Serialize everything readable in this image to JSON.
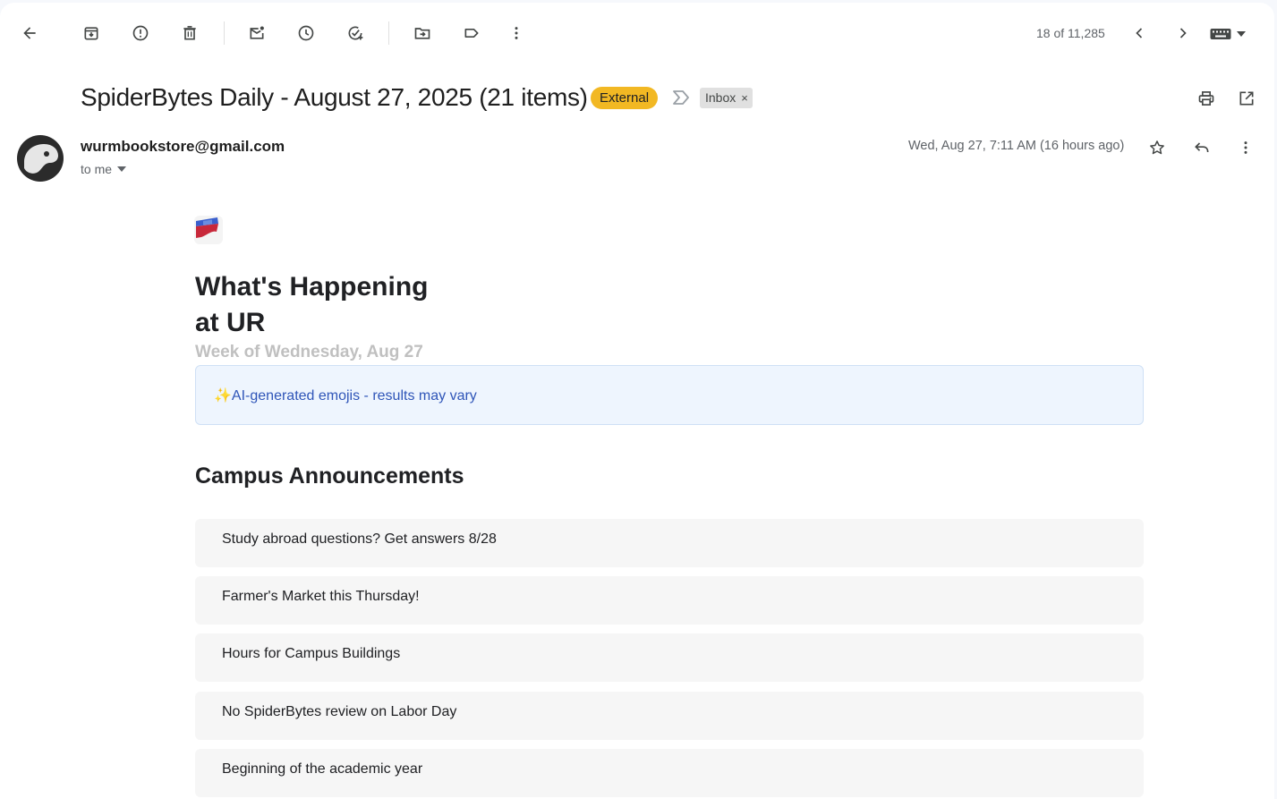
{
  "toolbar": {
    "counter": "18 of 11,285"
  },
  "email": {
    "subject": "SpiderBytes Daily - August 27, 2025 (21 items)",
    "external_label": "External",
    "label_chip": "Inbox",
    "label_chip_remove": "×",
    "sender": "wurmbookstore@gmail.com",
    "recipient": "to me",
    "date": "Wed, Aug 27, 7:11 AM (16 hours ago)"
  },
  "body": {
    "heading_line1": "What's Happening",
    "heading_line2": "at UR",
    "week": "Week of Wednesday, Aug 27",
    "ai_notice": "✨AI-generated emojis - results may vary",
    "section_title": "Campus Announcements",
    "items": [
      "Study abroad questions? Get answers 8/28",
      "Farmer's Market this Thursday!",
      "Hours for Campus Buildings",
      "No SpiderBytes review on Labor Day",
      "Beginning of the academic year"
    ]
  },
  "colors": {
    "external_badge": "#f2b823",
    "notice_bg": "#eef5fe",
    "notice_text": "#2f55b8",
    "item_bg": "#f6f6f6"
  }
}
